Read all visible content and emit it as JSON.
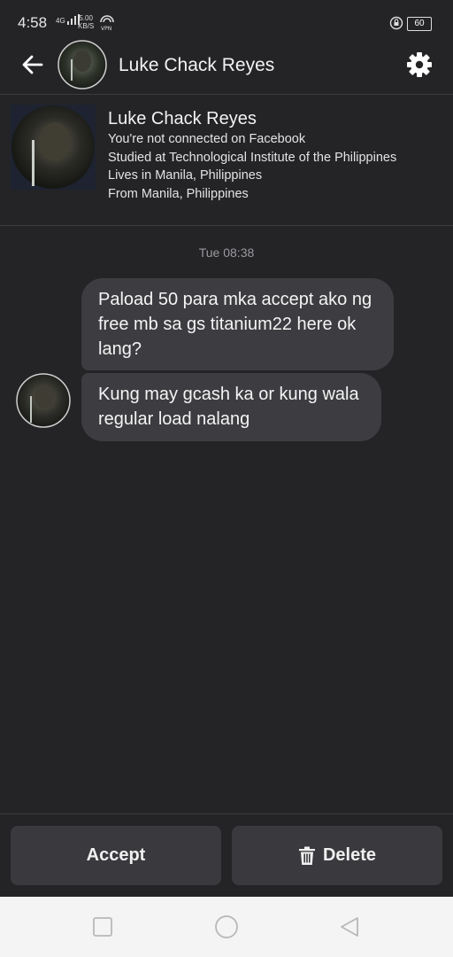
{
  "status_bar": {
    "time": "4:58",
    "network": "4G",
    "speed_value": "5.00",
    "speed_unit": "KB/S",
    "battery": "60",
    "icons": [
      "signal-icon",
      "vpn-icon",
      "lock-rotation-icon",
      "battery-icon"
    ]
  },
  "header": {
    "name": "Luke Chack Reyes",
    "icons": [
      "back-arrow-icon",
      "gear-icon"
    ]
  },
  "profile": {
    "name": "Luke Chack Reyes",
    "lines": [
      "You're not connected on Facebook",
      "Studied at Technological Institute of the Philippines",
      "Lives in Manila, Philippines",
      "From Manila, Philippines"
    ]
  },
  "conversation": {
    "timestamp": "Tue 08:38",
    "messages": [
      "Paload 50 para mka accept ako ng free mb sa gs titanium22 here ok lang?",
      "Kung may gcash ka or kung wala regular load nalang"
    ]
  },
  "actions": {
    "accept_label": "Accept",
    "delete_label": "Delete"
  },
  "nav": {
    "icons": [
      "recents-square-icon",
      "home-circle-icon",
      "back-triangle-icon"
    ]
  },
  "colors": {
    "background": "#242427",
    "bubble": "#3d3d41",
    "button": "#3a3a3e",
    "nav_bar": "#f4f4f4"
  }
}
